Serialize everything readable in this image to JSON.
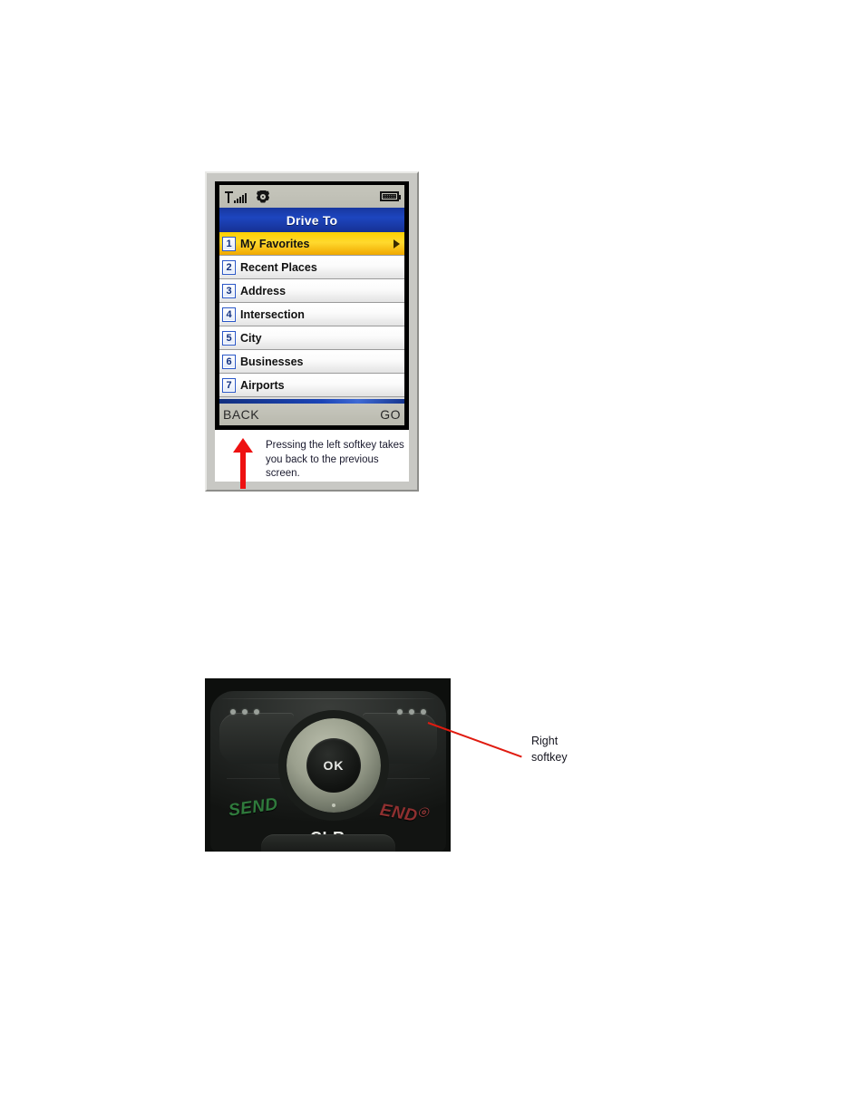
{
  "figure1": {
    "name": "drive-to-menu-screenshot",
    "status_bar": {
      "signal_icon": "signal-antenna-icon",
      "signal_bars": 5,
      "settings_icon": "gear-icon",
      "battery_icon": "battery-icon"
    },
    "title": "Drive To",
    "menu_items": [
      {
        "number": "1",
        "label": "My Favorites",
        "selected": true,
        "has_chevron": true
      },
      {
        "number": "2",
        "label": "Recent Places",
        "selected": false,
        "has_chevron": false
      },
      {
        "number": "3",
        "label": "Address",
        "selected": false,
        "has_chevron": false
      },
      {
        "number": "4",
        "label": "Intersection",
        "selected": false,
        "has_chevron": false
      },
      {
        "number": "5",
        "label": "City",
        "selected": false,
        "has_chevron": false
      },
      {
        "number": "6",
        "label": "Businesses",
        "selected": false,
        "has_chevron": false
      },
      {
        "number": "7",
        "label": "Airports",
        "selected": false,
        "has_chevron": false
      }
    ],
    "softkeys": {
      "left": "BACK",
      "right": "GO"
    },
    "caption": "Pressing the left softkey takes you back to the previous screen.",
    "arrow_icon": "up-arrow-icon",
    "colors": {
      "titlebar": "#1d45bf",
      "selected_row": "#ffd92e",
      "badge_border": "#2a57c8",
      "arrow": "#ee1111",
      "status_bar": "#c6c6bc",
      "softkey_bar": "#bfbfb4"
    }
  },
  "figure2": {
    "name": "keypad-photo",
    "keys": {
      "ok": "OK",
      "send": "SEND",
      "end": "END",
      "end_power_symbol": "ⓞ",
      "clr": "CLR"
    },
    "left_softkey_icon": "three-dots-icon",
    "right_softkey_icon": "three-dots-icon",
    "callout": {
      "label_line1": "Right",
      "label_line2": "softkey",
      "pointer_icon": "pointer-line-icon",
      "pointer_color": "#e01b10"
    }
  }
}
